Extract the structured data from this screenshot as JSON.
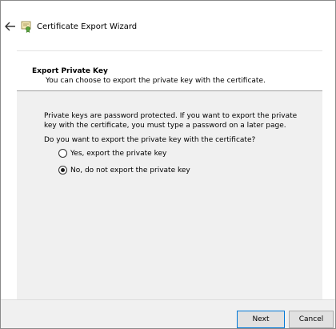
{
  "window": {
    "title": "Certificate Export Wizard"
  },
  "header": {
    "title": "Export Private Key",
    "subtitle": "You can choose to export the private key with the certificate."
  },
  "body": {
    "description": "Private keys are password protected. If you want to export the private key with the certificate, you must type a password on a later page.",
    "question": "Do you want to export the private key with the certificate?",
    "options": [
      {
        "label": "Yes, export the private key",
        "selected": false
      },
      {
        "label": "No, do not export the private key",
        "selected": true
      }
    ]
  },
  "footer": {
    "next_label": "Next",
    "cancel_label": "Cancel"
  },
  "colors": {
    "accent": "#0078d7",
    "body_bg": "#f0f0f0",
    "header_bg": "#ffffff"
  },
  "icons": {
    "back": "back-arrow-icon",
    "certificate": "certificate-icon"
  }
}
